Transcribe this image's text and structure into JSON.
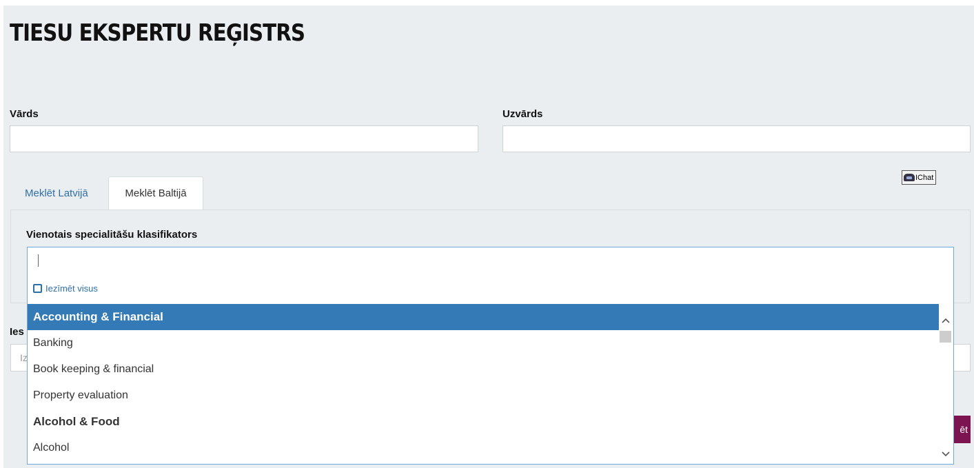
{
  "header": {
    "title": "TIESU EKSPERTU REĢISTRS"
  },
  "form": {
    "first_name": {
      "label": "Vārds",
      "value": ""
    },
    "last_name": {
      "label": "Uzvārds",
      "value": ""
    }
  },
  "ichat": {
    "label": "IChat"
  },
  "tabs": [
    {
      "label": "Meklēt Latvijā",
      "active": false
    },
    {
      "label": "Meklēt Baltijā",
      "active": true
    }
  ],
  "classifier": {
    "label": "Vienotais specialitāšu klasifikators",
    "search_value": "",
    "select_all_label": "Iezīmēt visus",
    "options": [
      {
        "label": "Accounting & Financial",
        "type": "group",
        "highlighted": true
      },
      {
        "label": "Banking",
        "type": "option"
      },
      {
        "label": "Book keeping & financial",
        "type": "option"
      },
      {
        "label": "Property evaluation",
        "type": "option"
      },
      {
        "label": "Alcohol & Food",
        "type": "group"
      },
      {
        "label": "Alcohol",
        "type": "option"
      }
    ]
  },
  "hidden_field": {
    "label_visible": "Ies",
    "placeholder_visible": "Iz"
  },
  "search_button": {
    "label_visible": "ēt"
  },
  "colors": {
    "page_background": "#ebeef1",
    "link": "#2f6fa7",
    "highlight": "#337ab7",
    "button": "#7b1450"
  }
}
